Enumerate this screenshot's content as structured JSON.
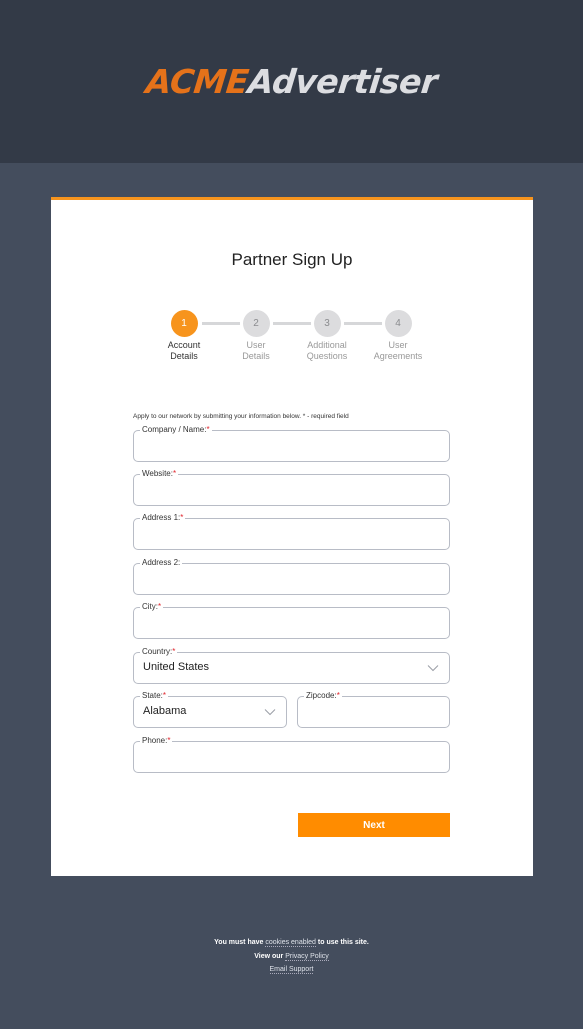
{
  "logo": {
    "part1": "ACME",
    "part2": "Advertiser"
  },
  "card": {
    "title": "Partner Sign Up",
    "accent_color": "#f7941d",
    "steps": [
      {
        "number": "1",
        "line1": "Account",
        "line2": "Details",
        "active": true
      },
      {
        "number": "2",
        "line1": "User",
        "line2": "Details",
        "active": false
      },
      {
        "number": "3",
        "line1": "Additional",
        "line2": "Questions",
        "active": false
      },
      {
        "number": "4",
        "line1": "User",
        "line2": "Agreements",
        "active": false
      }
    ],
    "intro": "Apply to our network by submitting your information below. * - required field",
    "required_marker": "*",
    "fields": {
      "company": {
        "label": "Company / Name:",
        "value": ""
      },
      "website": {
        "label": "Website:",
        "value": ""
      },
      "address1": {
        "label": "Address 1:",
        "value": ""
      },
      "address2": {
        "label": "Address 2:",
        "value": ""
      },
      "city": {
        "label": "City:",
        "value": ""
      },
      "country": {
        "label": "Country:",
        "value": "United States"
      },
      "state": {
        "label": "State:",
        "value": "Alabama"
      },
      "zipcode": {
        "label": "Zipcode:",
        "value": ""
      },
      "phone": {
        "label": "Phone:",
        "value": ""
      }
    },
    "next_label": "Next",
    "button_color": "#ff8c00"
  },
  "footer": {
    "line1_pre": "You must have ",
    "line1_link": "cookies enabled",
    "line1_post": " to use this site.",
    "line2_pre": "View our ",
    "line2_link": "Privacy Policy",
    "line3_link": "Email Support"
  }
}
